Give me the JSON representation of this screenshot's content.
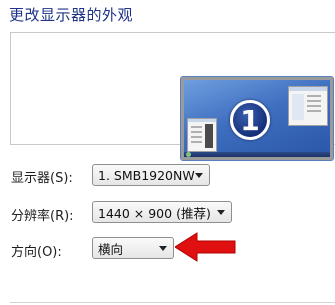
{
  "page_title": "更改显示器的外观",
  "preview": {
    "monitor_badge": "1"
  },
  "fields": {
    "display": {
      "label": "显示器(S):",
      "value": "1. SMB1920NW"
    },
    "resolution": {
      "label": "分辨率(R):",
      "value": "1440 × 900 (推荐)"
    },
    "orientation": {
      "label": "方向(O):",
      "value": "横向"
    }
  },
  "colors": {
    "title": "#1e3287",
    "monitor_blue": "#3f6fc0",
    "annotation_arrow": "#e01010"
  },
  "icons": {
    "annotation": "red-left-arrow",
    "dropdown": "chevron-down"
  }
}
